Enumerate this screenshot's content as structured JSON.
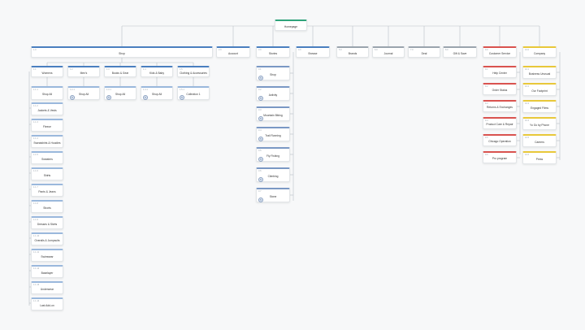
{
  "home": {
    "label": "Homepage",
    "color": "#2fa37a"
  },
  "top_level": [
    {
      "id": "shop",
      "num": "1.0",
      "label": "Shop",
      "color": "#4a7fbf"
    },
    {
      "id": "account",
      "num": "2.0",
      "label": "Account",
      "color": "#4a7fbf"
    },
    {
      "id": "stories",
      "num": "3.0",
      "label": "Stories",
      "color": "#4a7fbf"
    },
    {
      "id": "browse",
      "num": "4.0",
      "label": "Browse",
      "color": "#4a7fbf"
    },
    {
      "id": "brands",
      "num": "5.0",
      "label": "Brands",
      "color": "#9aa4ae"
    },
    {
      "id": "journal",
      "num": "6.0",
      "label": "Journal",
      "color": "#9aa4ae"
    },
    {
      "id": "deal",
      "num": "7.0",
      "label": "Deal",
      "color": "#9aa4ae"
    },
    {
      "id": "gift",
      "num": "8.0",
      "label": "Gift & Save",
      "color": "#9aa4ae"
    },
    {
      "id": "customer",
      "num": "9.0",
      "label": "Customer Service",
      "color": "#d9534f"
    },
    {
      "id": "company",
      "num": "10.0",
      "label": "Company",
      "color": "#e8c83a"
    }
  ],
  "shop_children": [
    {
      "num": "1.1",
      "label": "Womens"
    },
    {
      "num": "1.2",
      "label": "Men's"
    },
    {
      "num": "1.3",
      "label": "Books & Gear"
    },
    {
      "num": "1.4",
      "label": "Kids & Baby"
    },
    {
      "num": "1.5",
      "label": "Clothing & Accessories"
    }
  ],
  "shop_all": [
    {
      "num": "1.1.1",
      "label": "Shop All",
      "badge": ""
    },
    {
      "num": "1.2.1",
      "label": "Shop All",
      "badge": "5"
    },
    {
      "num": "1.3.1",
      "label": "Shop All",
      "badge": "5"
    },
    {
      "num": "1.4.1",
      "label": "Shop All",
      "badge": "5"
    },
    {
      "num": "1.5.1",
      "label": "Collection 1",
      "badge": "5"
    }
  ],
  "womens_list": [
    {
      "num": "1.1.2",
      "label": "Jackets & Vests"
    },
    {
      "num": "1.1.3",
      "label": "Fleece"
    },
    {
      "num": "1.1.4",
      "label": "Sweatshirts & Hoodies"
    },
    {
      "num": "1.1.5",
      "label": "Sweaters"
    },
    {
      "num": "1.1.6",
      "label": "Shirts"
    },
    {
      "num": "1.1.7",
      "label": "Pants & Jeans"
    },
    {
      "num": "1.1.8",
      "label": "Shorts"
    },
    {
      "num": "1.1.9",
      "label": "Dresses & Skirts"
    },
    {
      "num": "1.1.10",
      "label": "Overalls & Jumpsuits"
    },
    {
      "num": "1.1.11",
      "label": "Swimwear"
    },
    {
      "num": "1.1.12",
      "label": "Baselayer"
    },
    {
      "num": "1.1.13",
      "label": "Underwear"
    },
    {
      "num": "1.1.14",
      "label": "Last Add-on"
    }
  ],
  "stories_list": [
    {
      "num": "3.1",
      "label": "Shop",
      "badge": "5"
    },
    {
      "num": "3.2",
      "label": "Activity",
      "badge": "5"
    },
    {
      "num": "3.3",
      "label": "Mountain Biking",
      "badge": "5"
    },
    {
      "num": "3.4",
      "label": "Trail Running",
      "badge": "5"
    },
    {
      "num": "3.5",
      "label": "Fly Fishing",
      "badge": "5"
    },
    {
      "num": "3.6",
      "label": "Climbing",
      "badge": "5"
    },
    {
      "num": "3.7",
      "label": "Stone",
      "badge": "5"
    }
  ],
  "customer_list": [
    {
      "num": "9.1",
      "label": "Help Center"
    },
    {
      "num": "9.2",
      "label": "Order Status"
    },
    {
      "num": "9.3",
      "label": "Returns & Exchanges"
    },
    {
      "num": "9.4",
      "label": "Product Care & Repair"
    },
    {
      "num": "9.5",
      "label": "Chicago Operation"
    },
    {
      "num": "9.6",
      "label": "Pro program"
    }
  ],
  "company_list": [
    {
      "num": "10.1",
      "label": "Business Unusual"
    },
    {
      "num": "10.2",
      "label": "Our Footprint"
    },
    {
      "num": "10.3",
      "label": "Engaged Films"
    },
    {
      "num": "10.4",
      "label": "Yo Go by Phone"
    },
    {
      "num": "10.5",
      "label": "Careers"
    },
    {
      "num": "10.6",
      "label": "Press"
    }
  ]
}
